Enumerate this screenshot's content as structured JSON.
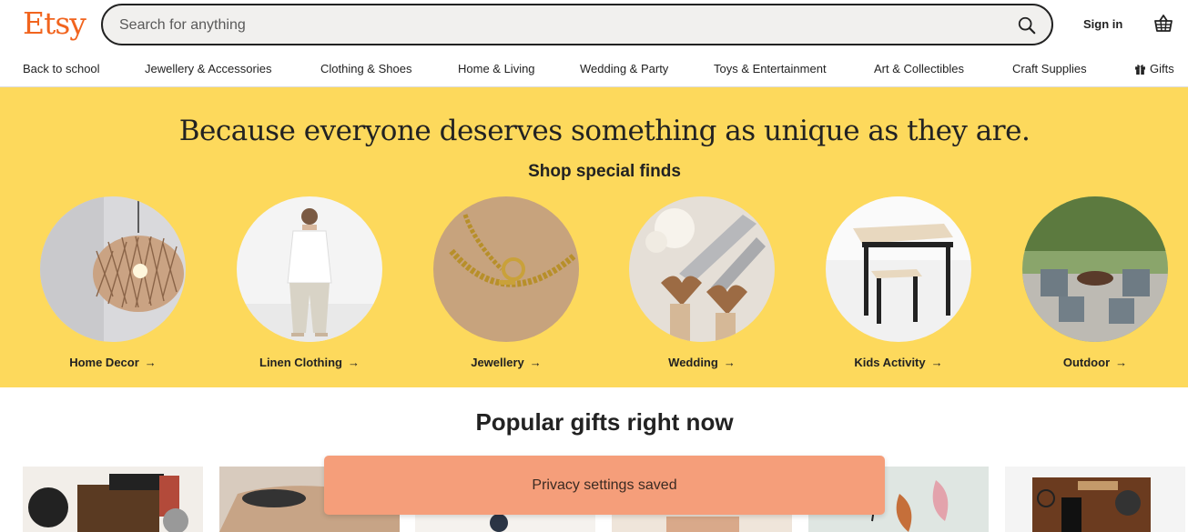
{
  "header": {
    "logo": "Etsy",
    "search_placeholder": "Search for anything",
    "signin_label": "Sign in"
  },
  "nav": {
    "items": [
      {
        "label": "Back to school"
      },
      {
        "label": "Jewellery & Accessories"
      },
      {
        "label": "Clothing & Shoes"
      },
      {
        "label": "Home & Living"
      },
      {
        "label": "Wedding & Party"
      },
      {
        "label": "Toys & Entertainment"
      },
      {
        "label": "Art & Collectibles"
      },
      {
        "label": "Craft Supplies"
      },
      {
        "label": "Gifts"
      }
    ]
  },
  "hero": {
    "title": "Because everyone deserves something as unique as they are.",
    "subtitle": "Shop special finds",
    "categories": [
      {
        "label": "Home Decor"
      },
      {
        "label": "Linen Clothing"
      },
      {
        "label": "Jewellery"
      },
      {
        "label": "Wedding"
      },
      {
        "label": "Kids Activity"
      },
      {
        "label": "Outdoor"
      }
    ]
  },
  "popular": {
    "title": "Popular gifts right now"
  },
  "toast": {
    "message": "Privacy settings saved"
  },
  "colors": {
    "brand": "#F1641E",
    "hero_bg": "#FDD95C",
    "toast_bg": "#F59E7A"
  }
}
